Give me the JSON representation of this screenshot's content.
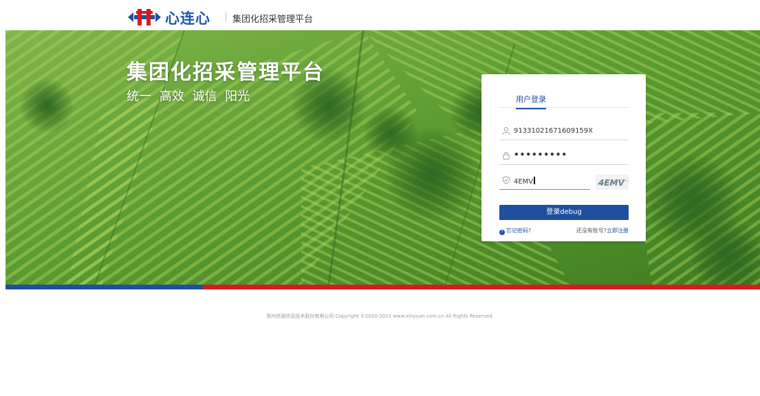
{
  "header": {
    "logo_text": "心连心",
    "platform_name": "集团化招采管理平台"
  },
  "banner": {
    "title": "集团化招采管理平台",
    "slogan": "统一  高效  诚信  阳光"
  },
  "login": {
    "tab_label": "用户登录",
    "username_value": "91331021671609159X",
    "password_mask": "•••••••••",
    "captcha_input_value": "4EMV",
    "captcha_image_text": "4EMV",
    "submit_label": "登录debug",
    "forgot_label": "忘记密码?",
    "register_prompt": "还没有账号?",
    "register_link": "立即注册"
  },
  "footer": {
    "copyright": "郑州信源信息技术股份有限公司 Copyright ©2020-2021 www.xinyuan.com.cn All Rights Reserved."
  },
  "colors": {
    "brand_blue": "#1f4fa0",
    "brand_red": "#d71920",
    "field_green": "#5f9e34"
  },
  "icons": [
    "logo-mark-icon",
    "user-icon",
    "lock-icon",
    "shield-icon",
    "question-icon"
  ]
}
